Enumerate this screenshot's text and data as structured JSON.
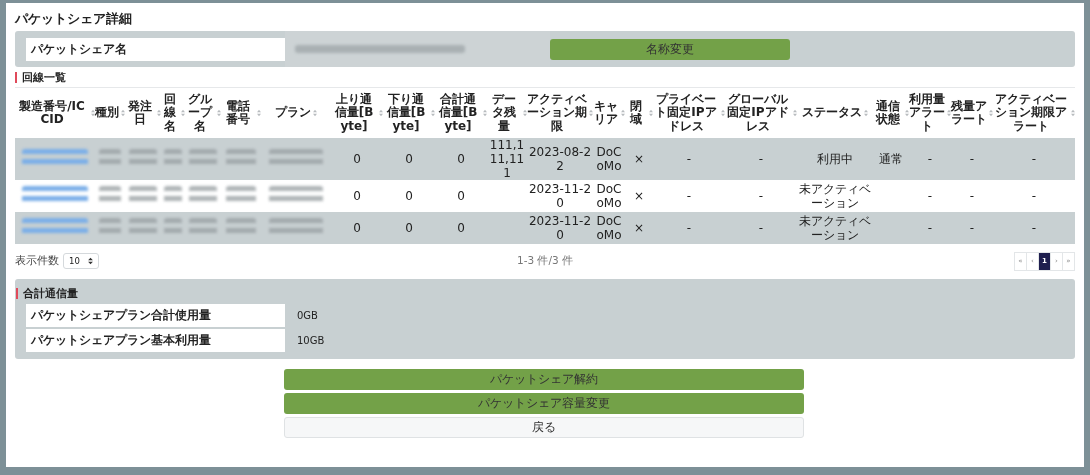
{
  "title": "パケットシェア詳細",
  "name_panel": {
    "label": "パケットシェア名",
    "value_redacted": true,
    "button": "名称変更"
  },
  "lines_section": {
    "heading": "回線一覧",
    "columns": [
      "製造番号/ICCID",
      "種別",
      "発注日",
      "回線名",
      "グループ名",
      "電話番号",
      "プラン",
      "上り通信量[Byte]",
      "下り通信量[Byte]",
      "合計通信量[Byte]",
      "データ残量",
      "アクティベーション期限",
      "キャリア",
      "閉域",
      "プライベート固定IPアドレス",
      "グローバル固定IPアドレス",
      "ステータス",
      "通信状態",
      "利用量アラート",
      "残量アラート",
      "アクティベーション期限アラート"
    ],
    "rows": [
      {
        "cells": [
          {
            "kind": "redacted-link"
          },
          {
            "kind": "redacted"
          },
          {
            "kind": "redacted"
          },
          {
            "kind": "redacted"
          },
          {
            "kind": "redacted"
          },
          {
            "kind": "redacted"
          },
          {
            "kind": "redacted"
          },
          {
            "kind": "text",
            "text": "0"
          },
          {
            "kind": "text",
            "text": "0"
          },
          {
            "kind": "text",
            "text": "0"
          },
          {
            "kind": "text",
            "text": "111,111,111"
          },
          {
            "kind": "text",
            "text": "2023-08-22"
          },
          {
            "kind": "text",
            "text": "DoCoMo"
          },
          {
            "kind": "text",
            "text": "×"
          },
          {
            "kind": "text",
            "text": "-"
          },
          {
            "kind": "text",
            "text": "-"
          },
          {
            "kind": "text",
            "text": "利用中"
          },
          {
            "kind": "text",
            "text": "通常"
          },
          {
            "kind": "text",
            "text": "-"
          },
          {
            "kind": "text",
            "text": "-"
          },
          {
            "kind": "text",
            "text": "-"
          }
        ]
      },
      {
        "cells": [
          {
            "kind": "redacted-link"
          },
          {
            "kind": "redacted"
          },
          {
            "kind": "redacted"
          },
          {
            "kind": "redacted"
          },
          {
            "kind": "redacted"
          },
          {
            "kind": "redacted"
          },
          {
            "kind": "redacted"
          },
          {
            "kind": "text",
            "text": "0"
          },
          {
            "kind": "text",
            "text": "0"
          },
          {
            "kind": "text",
            "text": "0"
          },
          {
            "kind": "empty"
          },
          {
            "kind": "text",
            "text": "2023-11-20"
          },
          {
            "kind": "text",
            "text": "DoCoMo"
          },
          {
            "kind": "text",
            "text": "×"
          },
          {
            "kind": "text",
            "text": "-"
          },
          {
            "kind": "text",
            "text": "-"
          },
          {
            "kind": "text",
            "text": "未アクティベーション"
          },
          {
            "kind": "empty"
          },
          {
            "kind": "text",
            "text": "-"
          },
          {
            "kind": "text",
            "text": "-"
          },
          {
            "kind": "text",
            "text": "-"
          }
        ]
      },
      {
        "cells": [
          {
            "kind": "redacted-link"
          },
          {
            "kind": "redacted"
          },
          {
            "kind": "redacted"
          },
          {
            "kind": "redacted"
          },
          {
            "kind": "redacted"
          },
          {
            "kind": "redacted"
          },
          {
            "kind": "redacted"
          },
          {
            "kind": "text",
            "text": "0"
          },
          {
            "kind": "text",
            "text": "0"
          },
          {
            "kind": "text",
            "text": "0"
          },
          {
            "kind": "empty"
          },
          {
            "kind": "text",
            "text": "2023-11-20"
          },
          {
            "kind": "text",
            "text": "DoCoMo"
          },
          {
            "kind": "text",
            "text": "×"
          },
          {
            "kind": "text",
            "text": "-"
          },
          {
            "kind": "text",
            "text": "-"
          },
          {
            "kind": "text",
            "text": "未アクティベーション"
          },
          {
            "kind": "empty"
          },
          {
            "kind": "text",
            "text": "-"
          },
          {
            "kind": "text",
            "text": "-"
          },
          {
            "kind": "text",
            "text": "-"
          }
        ]
      }
    ],
    "page_size_label": "表示件数",
    "page_size": "10",
    "count": "1-3 件/3 件",
    "pager": [
      {
        "label": "«",
        "selected": false
      },
      {
        "label": "‹",
        "selected": false
      },
      {
        "label": "1",
        "selected": true
      },
      {
        "label": "›",
        "selected": false
      },
      {
        "label": "»",
        "selected": false
      }
    ]
  },
  "total_section": {
    "heading": "合計通信量",
    "rows": [
      {
        "label": "パケットシェアプラン合計使用量",
        "value": "0GB"
      },
      {
        "label": "パケットシェアプラン基本利用量",
        "value": "10GB"
      }
    ]
  },
  "actions": [
    {
      "label": "パケットシェア解約",
      "kind": "primary"
    },
    {
      "label": "パケットシェア容量変更",
      "kind": "primary"
    },
    {
      "label": "戻る",
      "kind": "secondary"
    }
  ]
}
